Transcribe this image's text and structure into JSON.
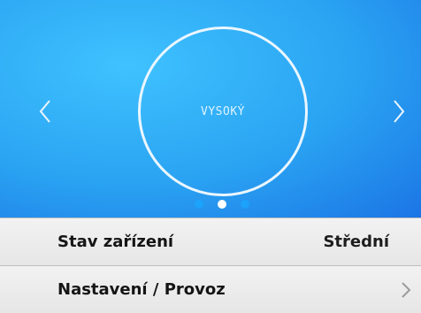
{
  "carousel": {
    "mode_label": "VYSOKÝ",
    "prev_icon": "chevron-left-icon",
    "next_icon": "chevron-right-icon",
    "page_count": 3,
    "active_page": 2
  },
  "menu": {
    "items": [
      {
        "label": "Stav zařízení",
        "value": "Střední"
      },
      {
        "label": "Nastavení / Provoz",
        "icon": "chevron-right-icon"
      }
    ]
  },
  "colors": {
    "hero_blue": "#2aa3f2",
    "ring": "#eaf6ff",
    "dot_active": "#ffffff",
    "dot_inactive": "#1aa7ff"
  }
}
